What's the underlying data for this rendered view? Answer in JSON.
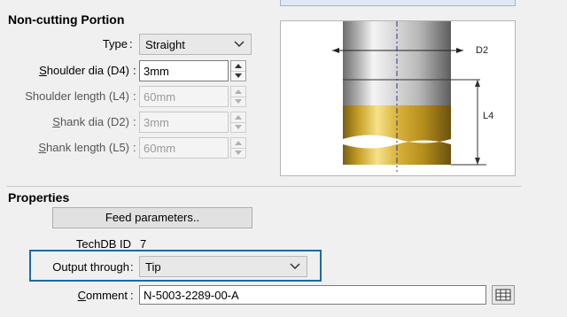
{
  "noncutting": {
    "title": "Non-cutting Portion",
    "type_label": "Type",
    "type_value": "Straight",
    "shoulder_dia_label_u": "S",
    "shoulder_dia_label_rest": "houlder dia (D4)",
    "shoulder_dia_value": "3mm",
    "shoulder_length_label": "Shoulder length (L4)",
    "shoulder_length_value": "60mm",
    "shank_dia_label_u": "S",
    "shank_dia_label_rest": "hank dia (D2)",
    "shank_dia_value": "3mm",
    "shank_length_label_u": "S",
    "shank_length_label_rest": "hank length (L5)",
    "shank_length_value": "60mm",
    "colon": ":"
  },
  "diagram": {
    "label_d2": "D2",
    "label_l4": "L4"
  },
  "properties": {
    "title": "Properties",
    "feed_button": "Feed parameters..",
    "techdb_label": "TechDB ID",
    "techdb_value": "7",
    "output_label": "Output through",
    "output_value": "Tip",
    "comment_label_u": "C",
    "comment_label_rest": "omment",
    "comment_value": "N-5003-2289-00-A",
    "colon": ":"
  },
  "colors": {
    "highlight": "#1a6aa8",
    "shank_gray": "#a9a9a9",
    "shoulder_gold": "#c9a227"
  }
}
